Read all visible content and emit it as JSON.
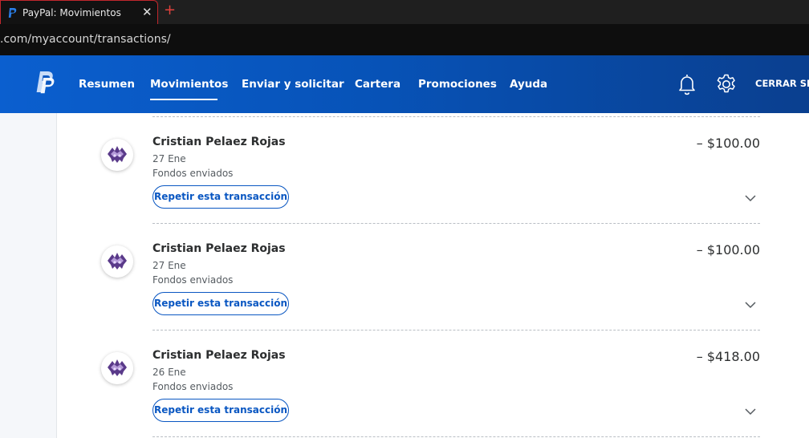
{
  "browser": {
    "tab_title": "PayPal: Movimientos",
    "tab_close": "✕",
    "new_tab": "+",
    "url": ".com/myaccount/transactions/"
  },
  "header": {
    "nav": [
      {
        "label": "Resumen"
      },
      {
        "label": "Movimientos",
        "active": true
      },
      {
        "label": "Enviar y solicitar"
      },
      {
        "label": "Cartera"
      },
      {
        "label": "Promociones"
      },
      {
        "label": "Ayuda"
      }
    ],
    "logout_label": "CERRAR SES",
    "icons": [
      "paypal-logo",
      "bell-icon",
      "gear-icon"
    ]
  },
  "transactions": [
    {
      "name": "Cristian Pelaez Rojas",
      "date": "27 Ene",
      "type": "Fondos enviados",
      "amount": "– $100.00",
      "action": "Repetir esta transacción"
    },
    {
      "name": "Cristian Pelaez Rojas",
      "date": "27 Ene",
      "type": "Fondos enviados",
      "amount": "– $100.00",
      "action": "Repetir esta transacción"
    },
    {
      "name": "Cristian Pelaez Rojas",
      "date": "26 Ene",
      "type": "Fondos enviados",
      "amount": "– $418.00",
      "action": "Repetir esta transacción"
    }
  ],
  "colors": {
    "header": "#0753b8",
    "accent": "#0a57c2",
    "tab_border": "#c1272d"
  }
}
